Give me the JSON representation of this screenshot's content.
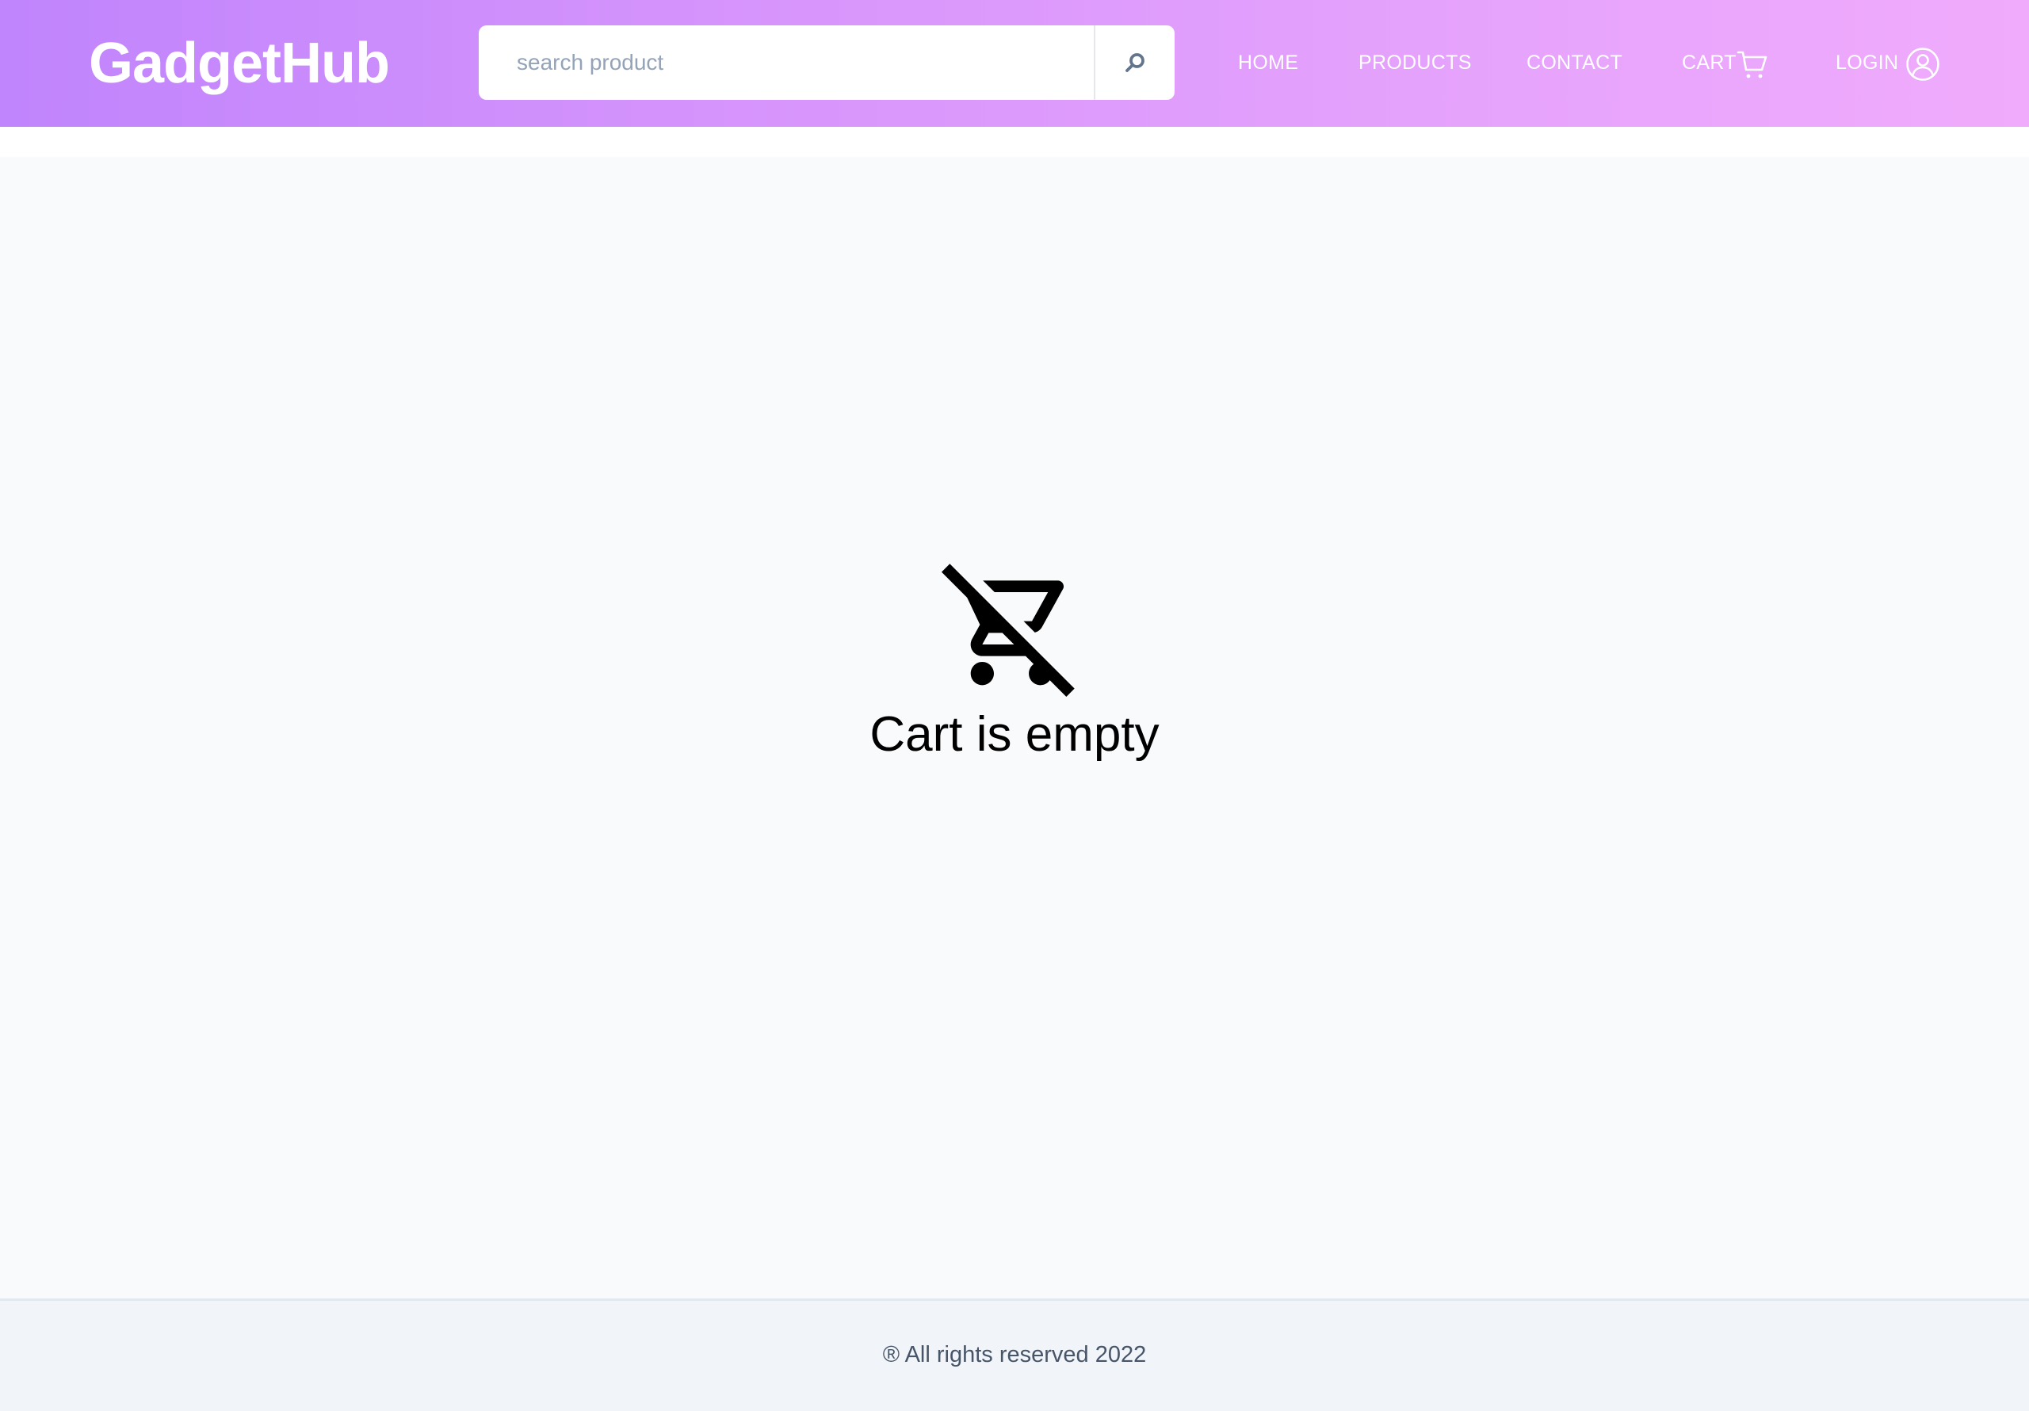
{
  "header": {
    "brand": "GadgetHub",
    "search": {
      "placeholder": "search product",
      "value": ""
    },
    "nav": {
      "home": "HOME",
      "products": "PRODUCTS",
      "contact": "CONTACT",
      "cart": "CART",
      "login": "LOGIN"
    }
  },
  "main": {
    "empty_message": "Cart is empty",
    "empty_icon": "remove-shopping-cart-icon"
  },
  "footer": {
    "text": "® All rights reserved 2022"
  },
  "colors": {
    "header_gradient_start": "#c084fc",
    "header_gradient_end": "#f0abfc",
    "main_background": "#f8fafc",
    "footer_background": "#f1f5f9"
  }
}
